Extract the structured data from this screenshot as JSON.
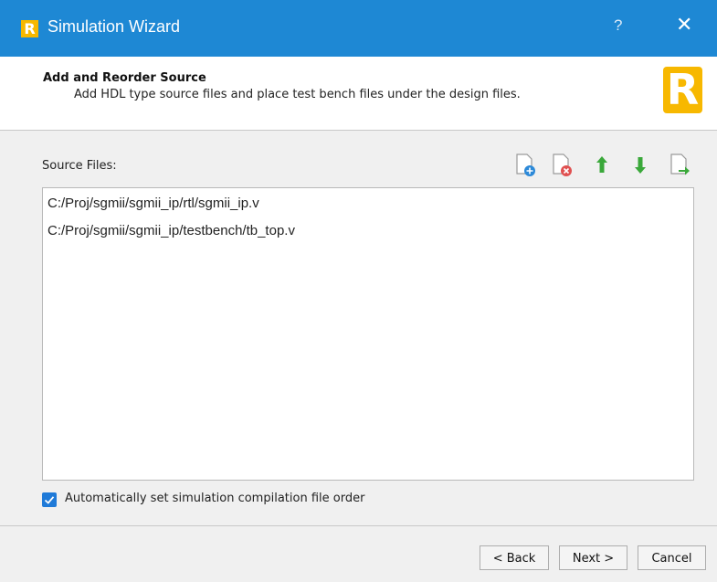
{
  "window": {
    "title": "Simulation Wizard",
    "help_label": "?",
    "close_label": "✕",
    "logo_letter": "R"
  },
  "header": {
    "title": "Add and Reorder Source",
    "description": "Add HDL type source files and place test bench files under the design files.",
    "logo_letter": "R"
  },
  "source": {
    "label": "Source Files:",
    "toolbar": [
      {
        "name": "add-file",
        "icon": "add-file-icon"
      },
      {
        "name": "remove-file",
        "icon": "remove-file-icon"
      },
      {
        "name": "move-up",
        "icon": "arrow-up-icon"
      },
      {
        "name": "move-down",
        "icon": "arrow-down-icon"
      },
      {
        "name": "import-file",
        "icon": "import-file-icon"
      }
    ],
    "files": [
      "C:/Proj/sgmii/sgmii_ip/rtl/sgmii_ip.v",
      "C:/Proj/sgmii/sgmii_ip/testbench/tb_top.v"
    ]
  },
  "options": {
    "auto_order_checked": true,
    "auto_order_label": "Automatically set simulation compilation file order"
  },
  "buttons": {
    "back": "< Back",
    "next": "Next >",
    "cancel": "Cancel"
  },
  "colors": {
    "titlebar": "#1e88d4",
    "accent": "#f7b800",
    "checkbox": "#1f7ad8"
  }
}
